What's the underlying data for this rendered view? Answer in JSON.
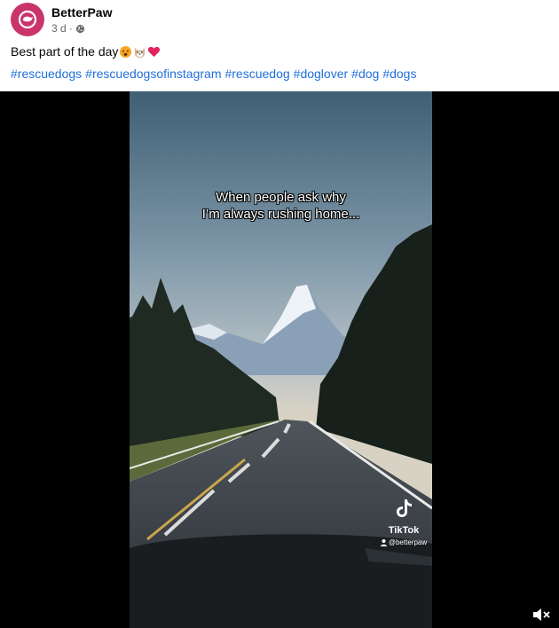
{
  "post": {
    "author": "BetterPaw",
    "time": "3 d",
    "separator": "·",
    "text": "Best part of the day",
    "emojis": [
      "hot-face-emoji",
      "dog-face-emoji",
      "red-heart-emoji"
    ],
    "hashtags": [
      "#rescuedogs",
      "#rescuedogsofinstagram",
      "#rescuedog",
      "#doglover",
      "#dog",
      "#dogs"
    ]
  },
  "video": {
    "caption_line1": "When people ask why",
    "caption_line2": "I’m always rushing home...",
    "watermark_brand": "TikTok",
    "watermark_handle": "@betterpaw",
    "mute_icon": "speaker-muted-icon"
  },
  "colors": {
    "avatar_bg": "#c9356b",
    "hashtag": "#216fdb",
    "meta": "#65676b"
  }
}
